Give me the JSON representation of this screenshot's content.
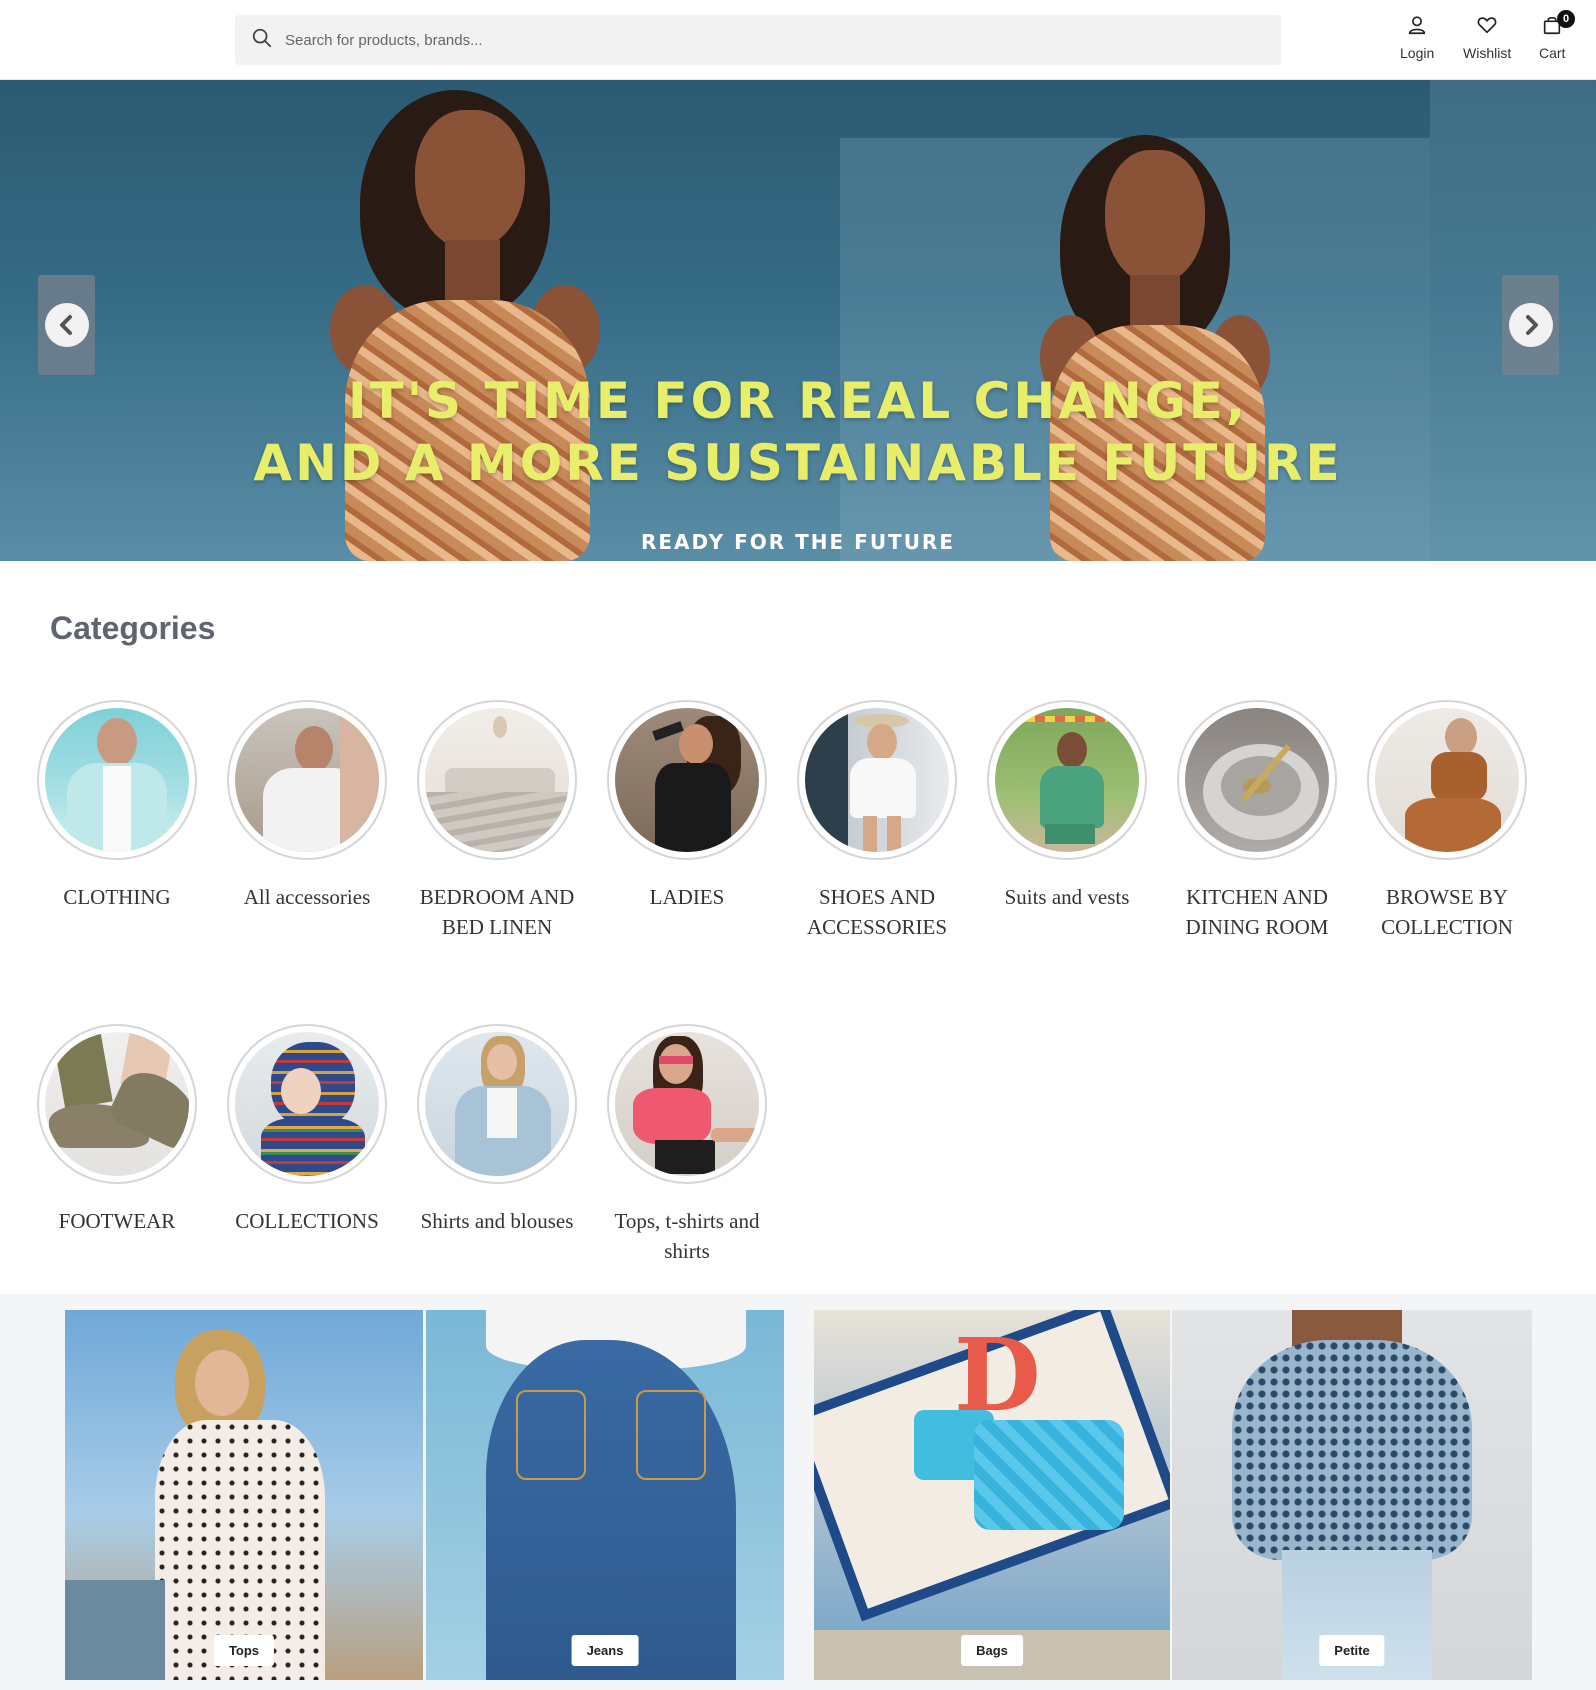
{
  "header": {
    "search_placeholder": "Search for products, brands...",
    "login_label": "Login",
    "wishlist_label": "Wishlist",
    "cart_label": "Cart",
    "cart_count": "0"
  },
  "hero": {
    "title_line1": "IT'S TIME FOR REAL CHANGE,",
    "title_line2": "AND A MORE SUSTAINABLE FUTURE",
    "subtitle": "READY FOR THE FUTURE",
    "accent_color": "#e8ee6a"
  },
  "categories": {
    "title": "Categories",
    "items": [
      {
        "label": "CLOTHING"
      },
      {
        "label": "All accessories"
      },
      {
        "label": "BEDROOM AND BED LINEN"
      },
      {
        "label": "LADIES"
      },
      {
        "label": "SHOES AND ACCESSORIES"
      },
      {
        "label": "Suits and vests"
      },
      {
        "label": "KITCHEN AND DINING ROOM"
      },
      {
        "label": "BROWSE BY COLLECTION"
      },
      {
        "label": "FOOTWEAR"
      },
      {
        "label": "COLLECTIONS"
      },
      {
        "label": "Shirts and blouses"
      },
      {
        "label": "Tops, t-shirts and shirts"
      }
    ]
  },
  "promos": [
    {
      "label": "Tops"
    },
    {
      "label": "Jeans"
    },
    {
      "label": "Bags"
    },
    {
      "label": "Petite"
    }
  ]
}
